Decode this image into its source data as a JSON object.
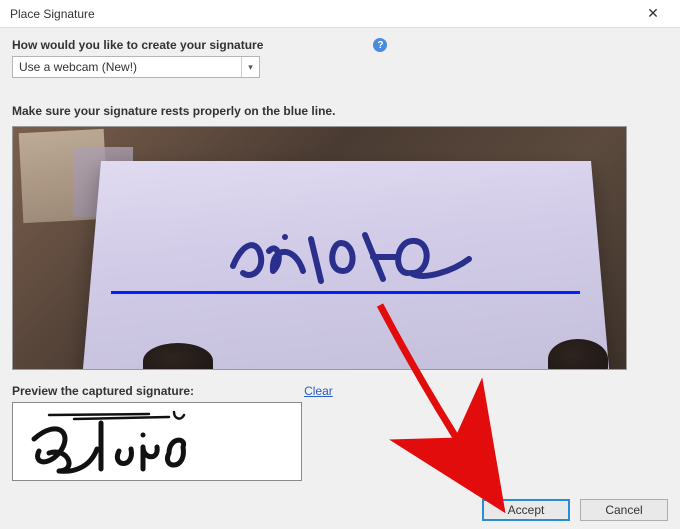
{
  "titlebar": {
    "title": "Place Signature",
    "close_glyph": "✕"
  },
  "question": {
    "label": "How would you like to create your signature",
    "help_glyph": "?",
    "selected": "Use a webcam (New!)",
    "arrow_glyph": "▾"
  },
  "instruction": "Make sure your signature rests properly on the blue line.",
  "preview": {
    "label": "Preview the captured signature:",
    "clear_label": "Clear"
  },
  "footer": {
    "accept_label": "Accept",
    "cancel_label": "Cancel"
  }
}
